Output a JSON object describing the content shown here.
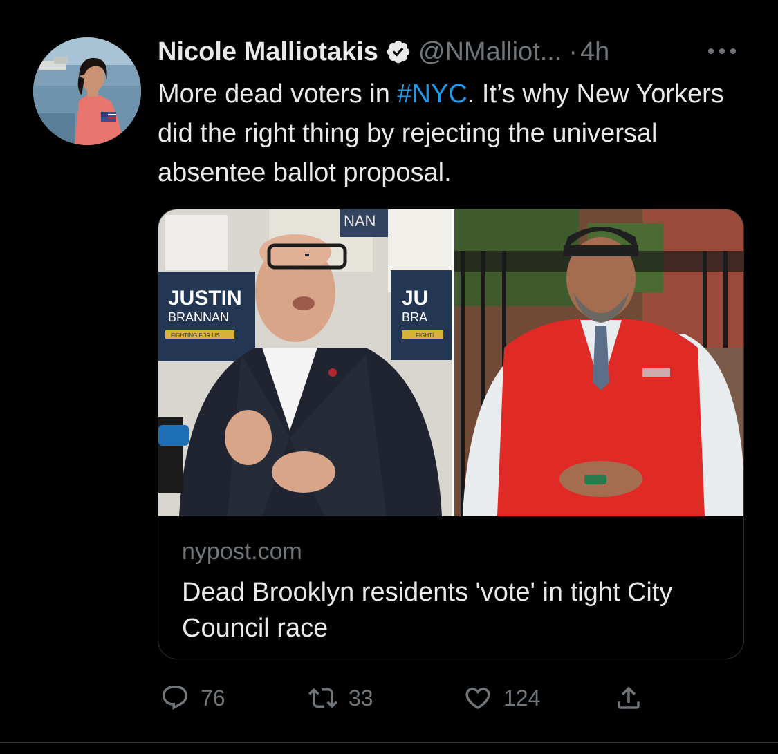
{
  "author": {
    "display_name": "Nicole Malliotakis",
    "handle": "@NMalliot...",
    "separator": "·",
    "time": "4h",
    "verified_icon": "verified-badge-icon",
    "more_icon": "more-horizontal-icon"
  },
  "tweet": {
    "text_before": "More dead voters in ",
    "hashtag": "#NYC",
    "text_after": ". It’s why New Yorkers did the right thing by rejecting the universal absentee ballot proposal."
  },
  "card": {
    "image_left": {
      "sign_name_first": "JUSTIN",
      "sign_name_last": "BRANNAN",
      "sign_tagline": "FIGHTING FOR US",
      "sign_name_first_partial": "JU",
      "sign_name_last_partial": "BRA",
      "sign_tagline_partial": "FIGHTI",
      "sign_top_partial": "NAN"
    },
    "domain": "nypost.com",
    "title": "Dead Brooklyn residents 'vote' in tight City Council race"
  },
  "actions": {
    "reply": {
      "icon": "reply-icon",
      "count": "76"
    },
    "retweet": {
      "icon": "retweet-icon",
      "count": "33"
    },
    "like": {
      "icon": "heart-icon",
      "count": "124"
    },
    "share": {
      "icon": "share-icon"
    }
  },
  "colors": {
    "background": "#000000",
    "text": "#e7e9ea",
    "secondary": "#71767b",
    "link": "#1d9bf0",
    "border": "#2f3336"
  }
}
